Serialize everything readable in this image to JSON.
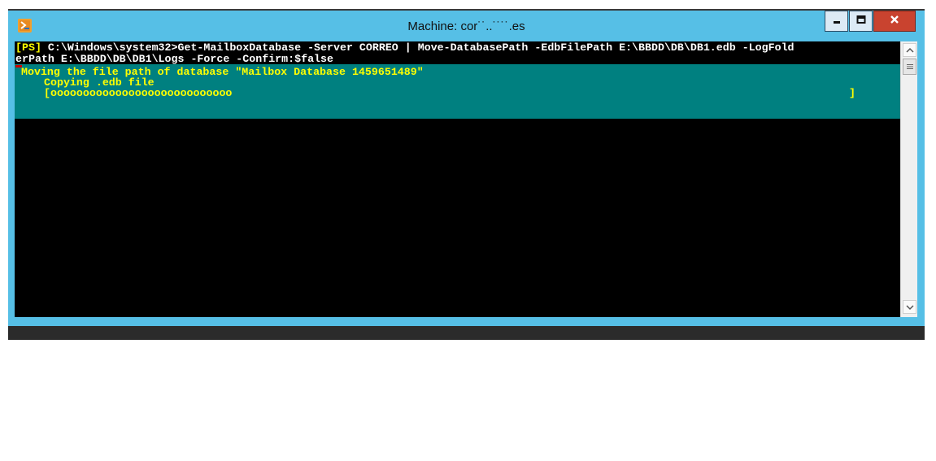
{
  "window": {
    "title": "Machine: cor˙˙..˙˙˙˙.es",
    "icon": "powershell-icon",
    "controls": {
      "minimize": "minimize-icon",
      "maximize": "maximize-icon",
      "close": "close-icon"
    }
  },
  "console": {
    "prompt_prefix": "[PS]",
    "command_line_1": " C:\\Windows\\system32>Get-MailboxDatabase -Server CORREO | Move-DatabasePath -EdbFilePath E:\\BBDD\\DB\\DB1.edb -LogFold",
    "command_line_2": "erPath E:\\BBDD\\DB\\DB1\\Logs -Force -Confirm:$false",
    "progress_activity": "Moving the file path of database \"Mailbox Database 1459651489\"",
    "progress_status": "Copying .edb file",
    "progress_bar_fill": "[oooooooooooooooooooooooooooo",
    "progress_bar_end": "]",
    "progress_fraction": 0.38
  },
  "colors": {
    "console_bg": "#000000",
    "progress_bg": "#008080",
    "progress_text": "#ffff00",
    "window_frame": "#56bfe6",
    "close_button": "#c9432f"
  }
}
